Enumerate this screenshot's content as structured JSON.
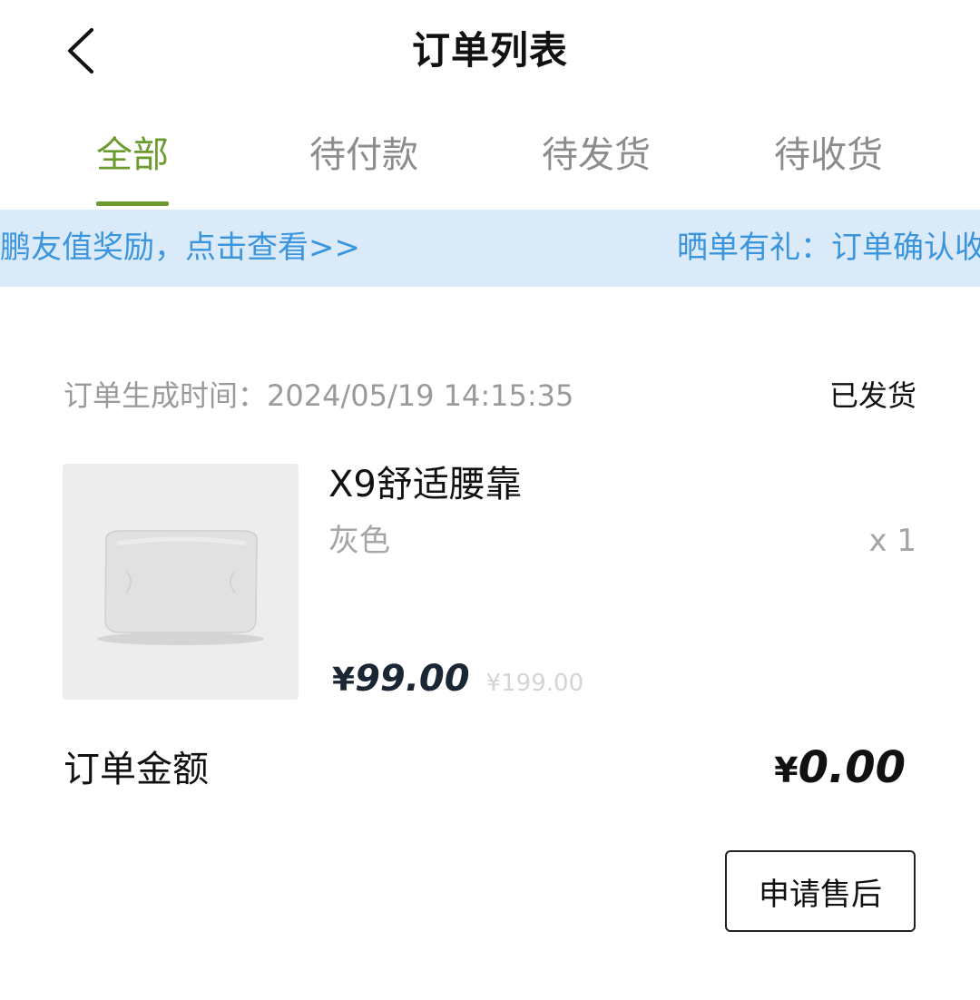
{
  "header": {
    "title": "订单列表",
    "back_icon": "chevron-left-icon"
  },
  "tabs": [
    {
      "label": "全部",
      "active": true
    },
    {
      "label": "待付款",
      "active": false
    },
    {
      "label": "待发货",
      "active": false
    },
    {
      "label": "待收货",
      "active": false
    }
  ],
  "marquee": {
    "items": [
      "加鹏友值奖励，点击查看>>",
      "晒单有礼：订单确认收"
    ]
  },
  "order": {
    "time_label": "订单生成时间：",
    "time_value": "2024/05/19 14:15:35",
    "status": "已发货",
    "product": {
      "name": "X9舒适腰靠",
      "variant": "灰色",
      "quantity": "x 1",
      "price_symbol": "¥",
      "price": "99.00",
      "original_price": "¥199.00",
      "image": "gray-lumbar-pillow"
    },
    "total_label": "订单金额",
    "total_symbol": "¥",
    "total_value": "0.00",
    "after_sale_button": "申请售后"
  },
  "colors": {
    "accent": "#6b9a2f",
    "marquee_bg": "#dbeaf9",
    "marquee_text": "#3a95dd",
    "muted_text": "#9a9a9a",
    "price_text": "#1a2633"
  }
}
